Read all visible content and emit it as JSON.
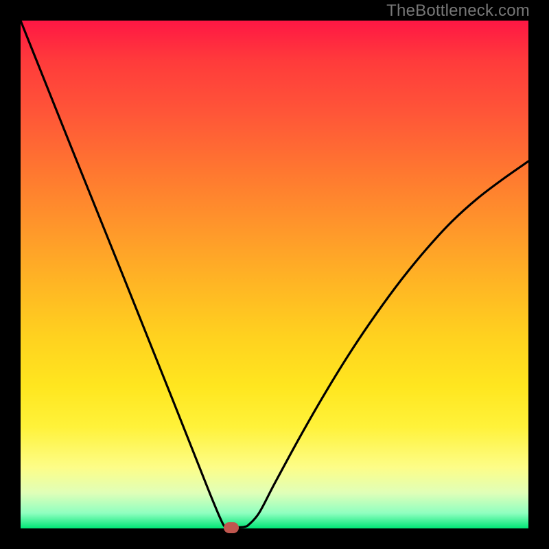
{
  "watermark_text": "TheBottleneck.com",
  "chart_data": {
    "type": "line",
    "title": "",
    "xlabel": "",
    "ylabel": "",
    "xlim": [
      0,
      100
    ],
    "ylim": [
      0,
      100
    ],
    "grid": false,
    "series": [
      {
        "name": "curve",
        "x": [
          0,
          5,
          10,
          15,
          20,
          25,
          30,
          35,
          38,
          40,
          41,
          42,
          44,
          45,
          47,
          50,
          55,
          60,
          65,
          70,
          75,
          80,
          85,
          90,
          95,
          100
        ],
        "y": [
          100,
          87.5,
          75,
          62.6,
          50.2,
          37.7,
          25.2,
          12.6,
          5.1,
          0.6,
          0.2,
          0.2,
          0.3,
          0.8,
          3.1,
          8.8,
          18.0,
          26.7,
          34.8,
          42.2,
          49.0,
          55.1,
          60.5,
          65.0,
          68.8,
          72.3
        ]
      }
    ],
    "annotations": [
      {
        "name": "min-marker",
        "x": 41.5,
        "y": 0.2
      }
    ],
    "gradient_stops": [
      {
        "pos": 0.0,
        "color": "#ff1744"
      },
      {
        "pos": 0.5,
        "color": "#ffb624"
      },
      {
        "pos": 0.85,
        "color": "#fff23a"
      },
      {
        "pos": 1.0,
        "color": "#00e676"
      }
    ]
  }
}
